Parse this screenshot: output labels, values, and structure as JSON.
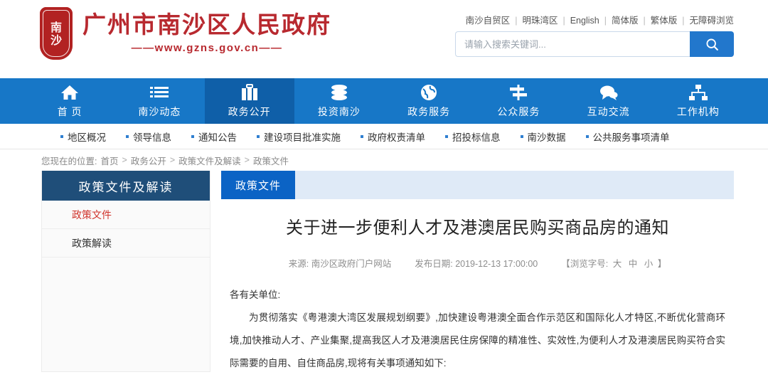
{
  "header": {
    "seal_chars": [
      "南",
      "沙"
    ],
    "site_title": "广州市南沙区人民政府",
    "site_url": "——www.gzns.gov.cn——",
    "top_links": [
      "南沙自贸区",
      "明珠湾区",
      "English",
      "简体版",
      "繁体版",
      "无障碍浏览"
    ],
    "separator": "|",
    "search": {
      "placeholder": "请输入搜索关键词...",
      "value": "",
      "icon": "search-icon",
      "button_color": "#2277cc"
    }
  },
  "main_nav": {
    "background": "#1777c7",
    "active_background": "#0f5fa8",
    "items": [
      {
        "label": "首 页",
        "icon": "home-icon",
        "active": false
      },
      {
        "label": "南沙动态",
        "icon": "list-icon",
        "active": false
      },
      {
        "label": "政务公开",
        "icon": "briefcase-icon",
        "active": true
      },
      {
        "label": "投资南沙",
        "icon": "database-icon",
        "active": false
      },
      {
        "label": "政务服务",
        "icon": "globe-icon",
        "active": false
      },
      {
        "label": "公众服务",
        "icon": "signpost-icon",
        "active": false
      },
      {
        "label": "互动交流",
        "icon": "chat-icon",
        "active": false
      },
      {
        "label": "工作机构",
        "icon": "org-chart-icon",
        "active": false
      }
    ]
  },
  "sub_nav": {
    "bullet_color": "#2f7fd0",
    "items": [
      "地区概况",
      "领导信息",
      "通知公告",
      "建设项目批准实施",
      "政府权责清单",
      "招投标信息",
      "南沙数据",
      "公共服务事项清单"
    ]
  },
  "breadcrumb": {
    "prefix": "您现在的位置:",
    "separator": ">",
    "items": [
      "首页",
      "政务公开",
      "政策文件及解读",
      "政策文件"
    ]
  },
  "sidebar": {
    "title": "政策文件及解读",
    "title_background": "#1f4e79",
    "items": [
      {
        "label": "政策文件",
        "active": true
      },
      {
        "label": "政策解读",
        "active": false
      }
    ],
    "active_color": "#d0342c"
  },
  "main": {
    "tab": {
      "label": "政策文件",
      "background": "#0b63c5",
      "bar_background": "#dfeaf7"
    },
    "article": {
      "title": "关于进一步便利人才及港澳居民购买商品房的通知",
      "source_label": "来源:",
      "source_value": "南沙区政府门户网站",
      "date_label": "发布日期:",
      "date_value": "2019-12-13 17:00:00",
      "fontsize_label": "【浏览字号:",
      "fontsize_options": [
        "大",
        "中",
        "小"
      ],
      "fontsize_close": "】",
      "paragraphs": [
        "各有关单位:",
        "为贯彻落实《粤港澳大湾区发展规划纲要》,加快建设粤港澳全面合作示范区和国际化人才特区,不断优化营商环境,加快推动人才、产业集聚,提高我区人才及港澳居民住房保障的精准性、实效性,为便利人才及港澳居民购买符合实际需要的自用、自住商品房,现将有关事项通知如下:"
      ]
    }
  }
}
